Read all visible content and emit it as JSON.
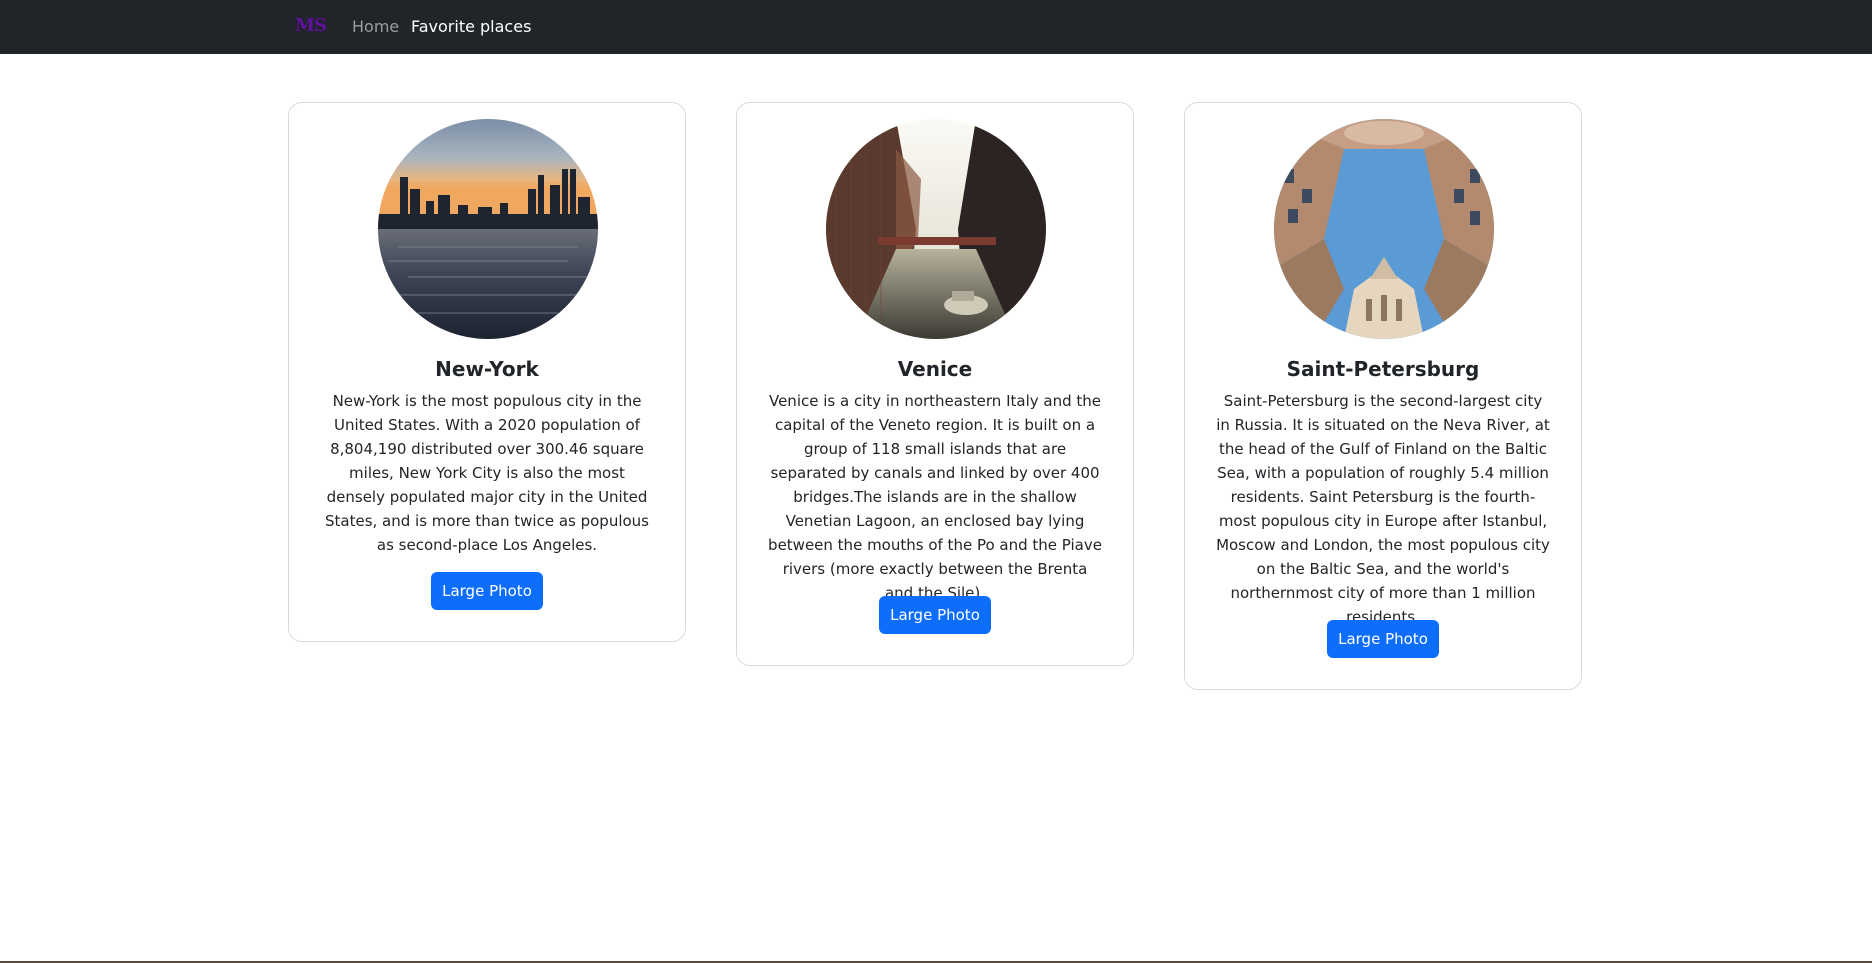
{
  "navbar": {
    "brand": "MS",
    "links": [
      {
        "label": "Home",
        "active": false
      },
      {
        "label": "Favorite places",
        "active": true
      }
    ]
  },
  "cards": [
    {
      "title": "New-York",
      "text": "New-York is the most populous city in the United States. With a 2020 population of 8,804,190 distributed over 300.46 square miles, New York City is also the most densely populated major city in the United States, and is more than twice as populous as second-place Los Angeles.",
      "button": "Large Photo"
    },
    {
      "title": "Venice",
      "text": "Venice is a city in northeastern Italy and the capital of the Veneto region. It is built on a group of 118 small islands that are separated by canals and linked by over 400 bridges.The islands are in the shallow Venetian Lagoon, an enclosed bay lying between the mouths of the Po and the Piave rivers (more exactly between the Brenta and the Sile).",
      "button": "Large Photo"
    },
    {
      "title": "Saint-Petersburg",
      "text": "Saint-Petersburg is the second-largest city in Russia. It is situated on the Neva River, at the head of the Gulf of Finland on the Baltic Sea, with a population of roughly 5.4 million residents. Saint Petersburg is the fourth-most populous city in Europe after Istanbul, Moscow and London, the most populous city on the Baltic Sea, and the world's northernmost city of more than 1 million residents.",
      "button": "Large Photo"
    }
  ],
  "colors": {
    "navbar_bg": "#212529",
    "brand": "#5b1496",
    "nav_inactive": "#9a9da0",
    "nav_active": "#ffffff",
    "button_bg": "#0d6efd",
    "card_border": "#d8dadd"
  }
}
